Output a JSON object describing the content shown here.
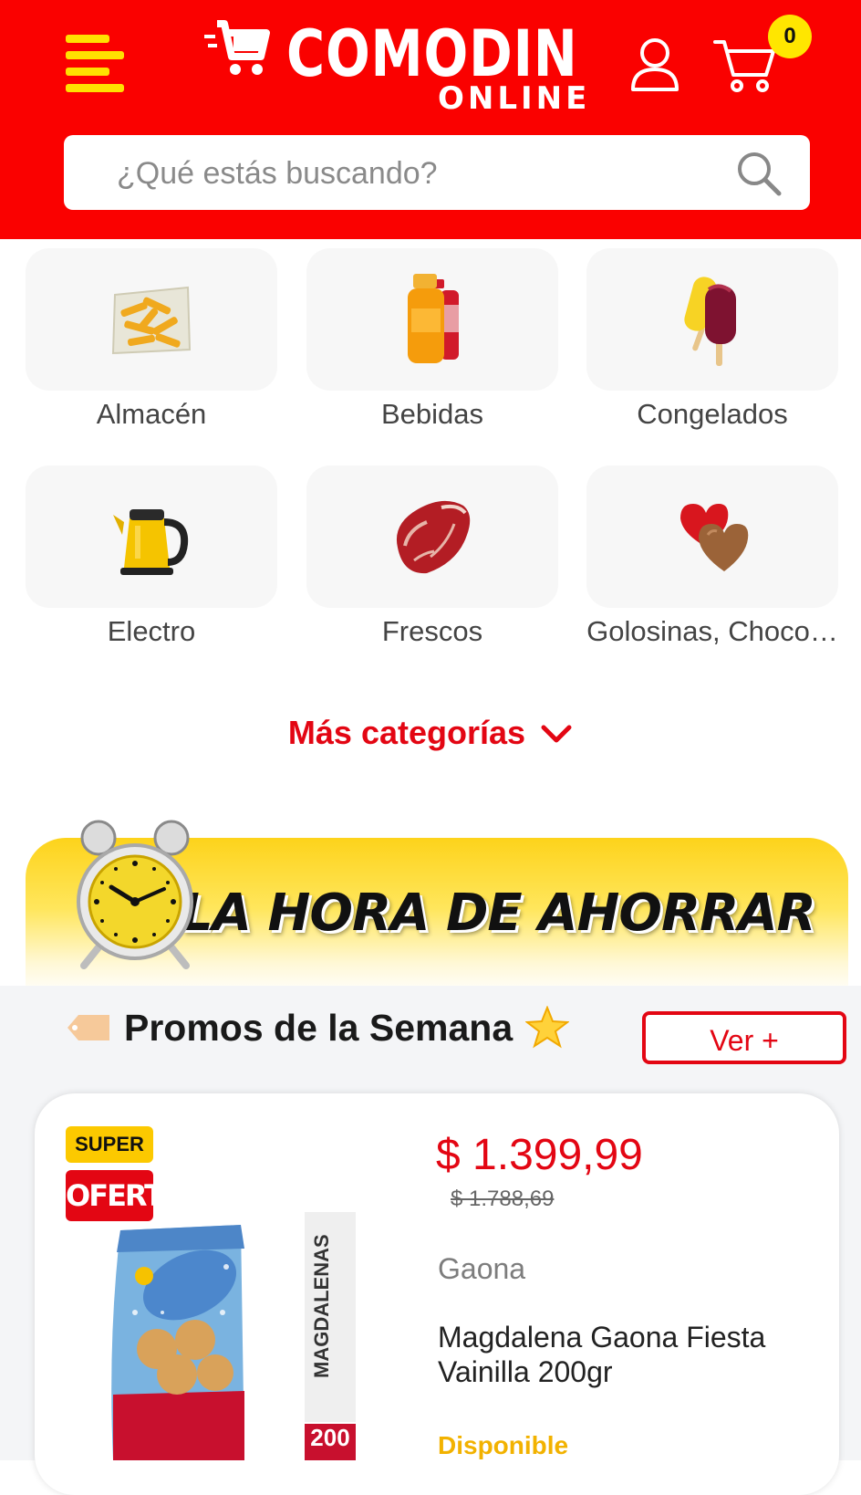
{
  "header": {
    "logo_main": "COMODIN",
    "logo_sub": "ONLINE",
    "cart_count": "0"
  },
  "search": {
    "placeholder": "¿Qué estás buscando?"
  },
  "categories": [
    {
      "label": "Almacén",
      "icon": "pasta-bag-icon"
    },
    {
      "label": "Bebidas",
      "icon": "juice-bottles-icon"
    },
    {
      "label": "Congelados",
      "icon": "ice-cream-icon"
    },
    {
      "label": "Electro",
      "icon": "kettle-icon"
    },
    {
      "label": "Frescos",
      "icon": "meat-icon"
    },
    {
      "label": "Golosinas, Choco…",
      "icon": "chocolate-heart-icon"
    }
  ],
  "more_categories": "Más categorías",
  "banner": {
    "text": "LA HORA DE AHORRAR"
  },
  "promos": {
    "title": "Promos de la Semana",
    "more_button": "Ver +"
  },
  "product": {
    "badge_top": "SUPER",
    "badge_bottom": "OFERTA",
    "price": "$ 1.399,99",
    "old_price": "$ 1.788,69",
    "brand": "Gaona",
    "name": "Magdalena Gaona Fiesta Vainilla 200gr",
    "availability": "Disponible",
    "package_side_text": "MAGDALENAS",
    "package_weight": "200"
  },
  "colors": {
    "brand_red": "#fa0100",
    "accent_yellow": "#ffe100",
    "price_red": "#e30613",
    "available_yellow": "#f2b200"
  }
}
